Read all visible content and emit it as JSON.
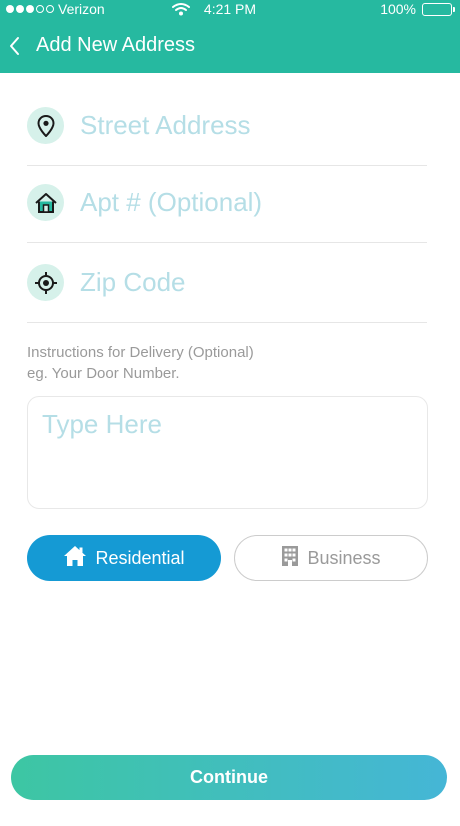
{
  "status_bar": {
    "carrier": "Verizon",
    "time": "4:21 PM",
    "battery": "100%",
    "signal_icon": "signal-dots-icon",
    "wifi_icon": "wifi-icon",
    "battery_icon": "battery-icon"
  },
  "nav": {
    "title": "Add New Address",
    "back_icon": "chevron-left-icon"
  },
  "form": {
    "street": {
      "placeholder": "Street Address",
      "value": "",
      "icon": "location-pin-icon"
    },
    "apt": {
      "placeholder": "Apt # (Optional)",
      "value": "",
      "icon": "home-icon"
    },
    "zip": {
      "placeholder": "Zip Code",
      "value": "",
      "icon": "crosshair-icon"
    },
    "instructions_label": "Instructions for Delivery (Optional)",
    "instructions_hint": "eg. Your Door Number.",
    "instructions_placeholder": "Type Here",
    "instructions_value": ""
  },
  "address_type": {
    "residential_label": "Residential",
    "residential_icon": "house-icon",
    "business_label": "Business",
    "business_icon": "building-icon",
    "selected": "Residential"
  },
  "continue_label": "Continue",
  "colors": {
    "header": "#26b9a0",
    "selected_button": "#159ad4",
    "placeholder": "#b5dee6",
    "icon_bg": "#d6f1ea",
    "continue_gradient_start": "#3dc6a3",
    "continue_gradient_end": "#45b6d6"
  }
}
